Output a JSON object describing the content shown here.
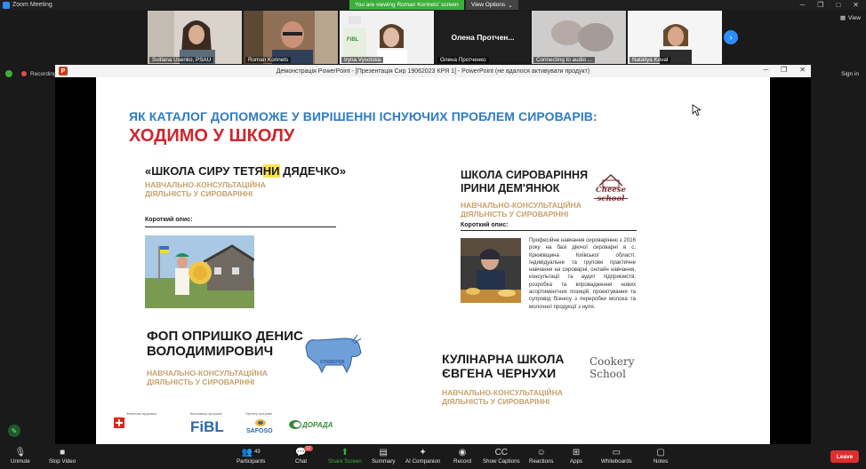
{
  "app": {
    "title": "Zoom Meeting"
  },
  "share": {
    "banner": "You are viewing Roman Korinets' screen",
    "view_options": "View Options"
  },
  "participants": [
    {
      "name": "Svitlana Usenko, PSAU"
    },
    {
      "name": "Roman Korinets"
    },
    {
      "name": "Iryna Vysotska"
    },
    {
      "name": "Олена Протченко",
      "center_label": "Олена  Протчен..."
    },
    {
      "name": "Connecting to audio ..."
    },
    {
      "name": "Nataliya Koval"
    }
  ],
  "header_right": {
    "view": "View",
    "signin": "Sign in"
  },
  "status": {
    "recording": "Recording"
  },
  "powerpoint": {
    "window_title": "Демонстрація PowerPoint - [Презентація Сир 19062023 КРЯ 1] - PowerPoint (не вдалося активувати продукт)"
  },
  "slide": {
    "heading": "ЯК КАТАЛОГ ДОПОМОЖЕ У ВИРІШЕННІ ІСНУЮЧИХ ПРОБЛЕМ СИРОВАРІВ:",
    "subheading": "ХОДИМО У ШКОЛУ",
    "school1": {
      "title_pre": "«ШКОЛА СИРУ ТЕТЯ",
      "title_hl": "НИ",
      "title_post": " ДЯДЕЧКО»",
      "tag1": "НАВЧАЛЬНО-КОНСУЛЬТАЦІЙНА",
      "tag2": "ДІЯЛЬНІСТЬ У СИРОВАРІННІ",
      "brief": "Короткий опис:"
    },
    "school2": {
      "title1": "ШКОЛА СИРОВАРІННЯ",
      "title2": "ІРИНИ ДЕМ'ЯНЮК",
      "logo": "Cheese school",
      "tag1": "НАВЧАЛЬНО-КОНСУЛЬТАЦІЙНА",
      "tag2": "ДІЯЛЬНІСТЬ У СИРОВАРІННІ",
      "brief": "Короткий опис:",
      "description": "Професійне навчання сироварінню з 2016 року на базі діючої сироварні в с. Крюківщина Київської області. Індивідуальне та групове практичне навчання на сироварні, онлайн навчання, консультації та аудит підприємств, розробка та впровадження нових асортиментних позицій, проектування та супровід бізнесу з переробки молока та молочної продукції з нуля."
    },
    "school3": {
      "title1": "ФОП ОПРИШКО ДЕНИС",
      "title2": "ВОЛОДИМИРОВИЧ",
      "logo": "ОТЕВЕРЕВ",
      "tag1": "НАВЧАЛЬНО-КОНСУЛЬТАЦІЙНА",
      "tag2": "ДІЯЛЬНІСТЬ У СИРОВАРІННІ"
    },
    "school4": {
      "title1": "КУЛІНАРНА ШКОЛА",
      "title2": "ЄВГЕНА ЧЕРНУХИ",
      "logo1": "Cookery",
      "logo2": "School",
      "tag1": "НАВЧАЛЬНО-КОНСУЛЬТАЦІЙНА",
      "tag2": "ДІЯЛЬНІСТЬ У СИРОВАРІННІ"
    },
    "footer": {
      "supported_by": "Фінансова підтримка",
      "implementer": "Виконавець програми",
      "partner": "Партнер програми",
      "fibl": "FiBL",
      "safoso": "SAFOSO",
      "dorada": "ДОРАДА"
    }
  },
  "toolbar": {
    "unmute": "Unmute",
    "stop_video": "Stop Video",
    "participants": "Participants",
    "participants_count": "49",
    "chat": "Chat",
    "chat_badge": "12",
    "share_screen": "Share Screen",
    "summary": "Summary",
    "ai_companion": "AI Companion",
    "record": "Record",
    "show_captions": "Show Captions",
    "reactions": "Reactions",
    "apps": "Apps",
    "whiteboards": "Whiteboards",
    "notes": "Notes",
    "leave": "Leave"
  }
}
